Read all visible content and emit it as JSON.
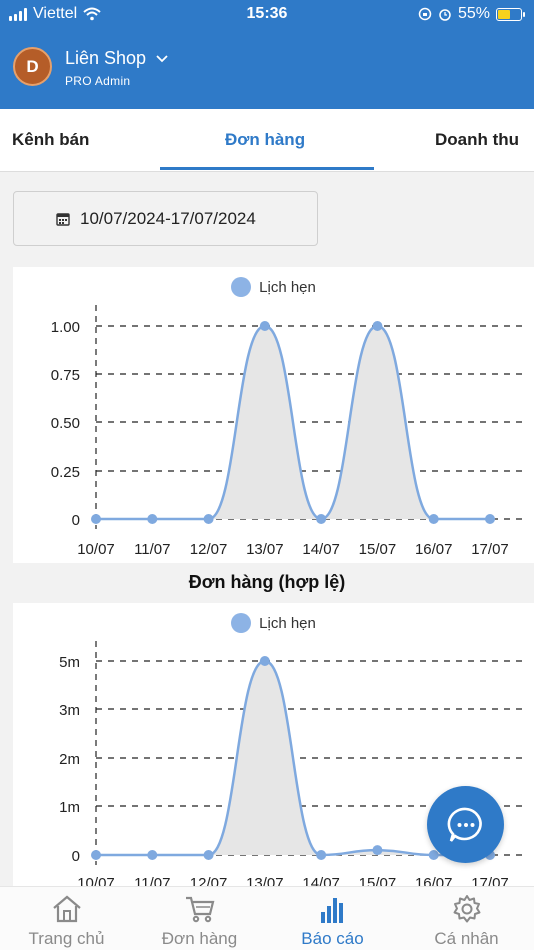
{
  "status_bar": {
    "carrier": "Viettel",
    "time": "15:36",
    "battery": "55%"
  },
  "header": {
    "avatar_letter": "D",
    "shop_name": "Liên Shop",
    "role": "PRO  Admin"
  },
  "tabs": [
    {
      "label": "Kênh bán",
      "active": false
    },
    {
      "label": "Đơn hàng",
      "active": true
    },
    {
      "label": "Doanh thu",
      "active": false
    }
  ],
  "date_range": "10/07/2024-17/07/2024",
  "chart_data": [
    {
      "type": "area",
      "title": "",
      "legend": [
        "Lịch hẹn"
      ],
      "categories": [
        "10/07",
        "11/07",
        "12/07",
        "13/07",
        "14/07",
        "15/07",
        "16/07",
        "17/07"
      ],
      "series": [
        {
          "name": "Lịch hẹn",
          "values": [
            0,
            0,
            0,
            1,
            0,
            1,
            0,
            0
          ]
        }
      ],
      "yticks": [
        "0",
        "0.25",
        "0.50",
        "0.75",
        "1.00"
      ],
      "ylim": [
        0,
        1
      ],
      "grid": true,
      "legend_position": "top-center"
    },
    {
      "type": "area",
      "title": "Đơn hàng (hợp lệ)",
      "legend": [
        "Lịch hẹn"
      ],
      "categories": [
        "10/07",
        "11/07",
        "12/07",
        "13/07",
        "14/07",
        "15/07",
        "16/07",
        "17/07"
      ],
      "series": [
        {
          "name": "Lịch hẹn",
          "values": [
            0,
            0,
            0,
            4000000,
            0,
            100000,
            0,
            0
          ]
        }
      ],
      "yticks": [
        "0",
        "1m",
        "2m",
        "3m",
        "5m"
      ],
      "ylim": [
        0,
        4000000
      ],
      "grid": true,
      "legend_position": "top-center"
    }
  ],
  "bottom_nav": [
    {
      "label": "Trang chủ",
      "icon": "home-icon",
      "active": false
    },
    {
      "label": "Đơn hàng",
      "icon": "cart-icon",
      "active": false
    },
    {
      "label": "Báo cáo",
      "icon": "bar-chart-icon",
      "active": true
    },
    {
      "label": "Cá nhân",
      "icon": "gear-icon",
      "active": false
    }
  ],
  "colors": {
    "primary": "#2f7ac8",
    "series_line": "#7fa9df",
    "series_fill": "#e6e6e6"
  }
}
